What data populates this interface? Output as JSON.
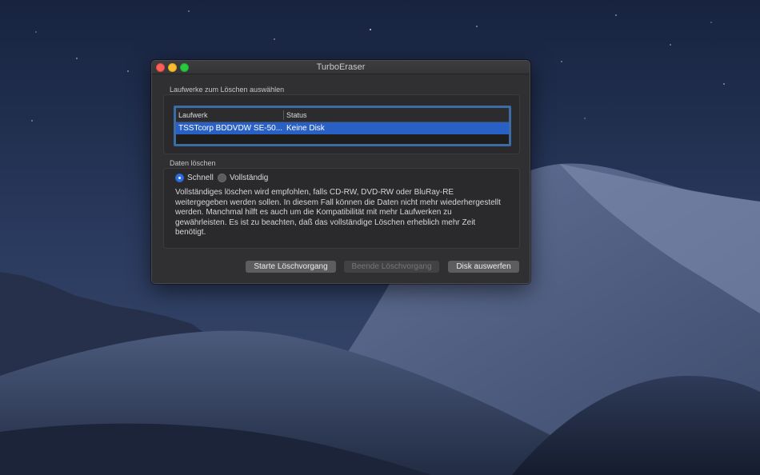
{
  "window": {
    "title": "TurboEraser"
  },
  "drives_group": {
    "label": "Laufwerke zum Löschen auswählen",
    "columns": [
      "Laufwerk",
      "Status"
    ],
    "rows": [
      {
        "drive": "TSSTcorp BDDVDW SE-50...",
        "status": "Keine Disk",
        "selected": true
      }
    ]
  },
  "erase_group": {
    "label": "Daten löschen",
    "options": [
      {
        "label": "Schnell",
        "selected": true
      },
      {
        "label": "Vollständig",
        "selected": false
      }
    ],
    "description_lines": [
      "Vollständiges löschen wird empfohlen, falls CD-RW, DVD-RW oder BluRay-RE",
      "weitergegeben werden sollen. In diesem Fall können die Daten nicht mehr wiederhergestellt",
      "werden. Manchmal hilft es auch um die Kompatibilität mit mehr Laufwerken zu",
      "gewährleisten. Es ist zu beachten, daß das vollständige Löschen erheblich mehr Zeit",
      "benötigt."
    ]
  },
  "buttons": {
    "start": {
      "label": "Starte Löschvorgang",
      "enabled": true
    },
    "stop": {
      "label": "Beende Löschvorgang",
      "enabled": false
    },
    "eject": {
      "label": "Disk auswerfen",
      "enabled": true
    }
  },
  "colors": {
    "selection": "#2860c6",
    "focus_ring": "#3b6ca6",
    "radio_on": "#2e6fe0",
    "close": "#fc5f57",
    "minimize": "#fdbc2e",
    "maximize": "#28c840"
  }
}
